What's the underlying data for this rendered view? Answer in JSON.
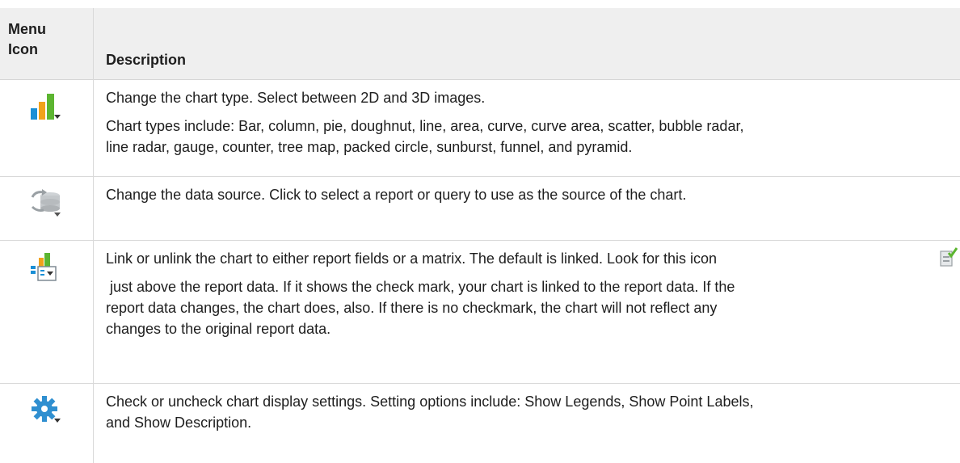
{
  "table": {
    "header": {
      "icon_col": "Menu\nIcon",
      "desc_col": "Description"
    },
    "rows": [
      {
        "icon": "chart-type-icon",
        "paragraphs": [
          "Change the chart type. Select between 2D and 3D images.",
          "Chart types include: Bar, column, pie, doughnut, line, area, curve, curve area, scatter, bubble radar,\nline radar, gauge, counter, tree map, packed circle, sunburst, funnel, and pyramid."
        ]
      },
      {
        "icon": "data-source-icon",
        "paragraphs": [
          "Change the data source. Click to select a report or query to use as the source of the chart."
        ]
      },
      {
        "icon": "link-chart-icon",
        "paragraphs": [
          "Link or unlink the chart to either report fields or a matrix. The default is linked. Look for this icon",
          " just above the report data. If it shows the check mark, your chart is linked to the report data. If the\nreport data changes, the chart does, also. If there is no checkmark, the chart will not reflect any\nchanges to the original report data."
        ],
        "inline_icon": "linked-chart-check-icon"
      },
      {
        "icon": "settings-gear-icon",
        "paragraphs": [
          "Check or uncheck chart display settings. Setting options include: Show Legends, Show Point Labels,\nand Show Description."
        ]
      }
    ]
  },
  "colors": {
    "header_bg": "#efefef",
    "divider": "#d9d9d9",
    "text": "#1e1e1e",
    "bar_blue": "#1a8fd6",
    "bar_orange": "#f2a21a",
    "bar_green": "#5cb531",
    "gear_blue": "#2f8fd0"
  }
}
